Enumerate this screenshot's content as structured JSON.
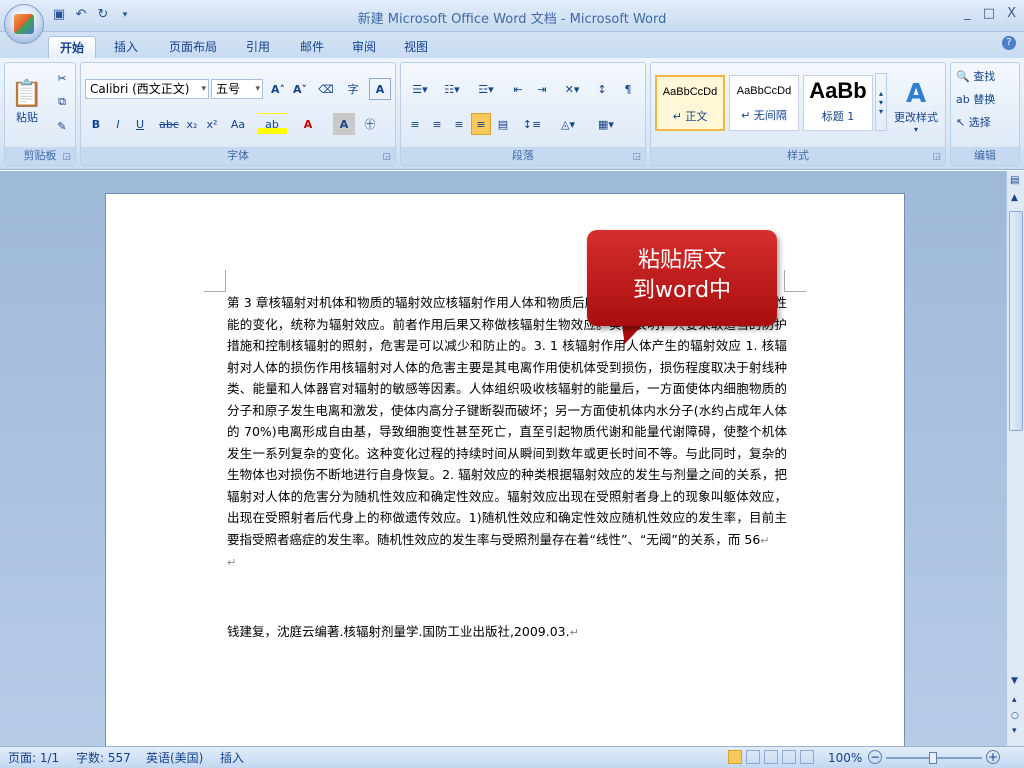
{
  "window": {
    "title": "新建 Microsoft Office Word 文档 - Microsoft Word",
    "min": "_",
    "max": "□",
    "close": "X"
  },
  "tabs": [
    "开始",
    "插入",
    "页面布局",
    "引用",
    "邮件",
    "审阅",
    "视图"
  ],
  "ribbon": {
    "clipboard": {
      "paste": "粘贴",
      "label": "剪贴板"
    },
    "font": {
      "name": "Calibri (西文正文)",
      "size": "五号",
      "label": "字体"
    },
    "paragraph": {
      "label": "段落"
    },
    "styles": {
      "label": "样式",
      "items": [
        {
          "preview": "AaBbCcDd",
          "name": "↵ 正文"
        },
        {
          "preview": "AaBbCcDd",
          "name": "↵ 无间隔"
        },
        {
          "preview": "AaBb",
          "name": "标题 1"
        }
      ],
      "change": "更改样式"
    },
    "editing": {
      "find": "查找",
      "replace": "替换",
      "select": "选择",
      "label": "编辑"
    }
  },
  "callout": {
    "line1": "粘贴原文",
    "line2": "到word中"
  },
  "document": {
    "body": "第 3 章核辐射对机体和物质的辐射效应核辐射作用人体和物质后所产生的各种生物学变化以及物质性能的变化，统称为辐射效应。前者作用后果又称做核辐射生物效应。实践表明，只要采取适当的防护措施和控制核辐射的照射，危害是可以减少和防止的。3. 1 核辐射作用人体产生的辐射效应 1. 核辐射对人体的损伤作用核辐射对人体的危害主要是其电离作用使机体受到损伤，损伤程度取决于射线种类、能量和人体器官对辐射的敏感等因素。人体组织吸收核辐射的能量后，一方面使体内细胞物质的分子和原子发生电离和激发，使体内高分子键断裂而破坏；另一方面使机体内水分子(水约占成年人体的 70%)电离形成自由基，导致细胞变性甚至死亡，直至引起物质代谢和能量代谢障碍，使整个机体发生一系列复杂的变化。这种变化过程的持续时间从瞬间到数年或更长时间不等。与此同时，复杂的生物体也对损伤不断地进行自身恢复。2. 辐射效应的种类根据辐射效应的发生与剂量之间的关系，把辐射对人体的危害分为随机性效应和确定性效应。辐射效应出现在受照射者身上的现象叫躯体效应，出现在受照射者后代身上的称做遗传效应。1)随机性效应和确定性效应随机性效应的发生率，目前主要指受照者癌症的发生率。随机性效应的发生率与受照剂量存在着“线性”、“无阈”的关系，而 56",
    "empty_mark": "↵",
    "citation": "钱建复，沈庭云编著.核辐射剂量学.国防工业出版社,2009.03."
  },
  "status": {
    "page": "页面: 1/1",
    "words": "字数: 557",
    "language": "英语(美国)",
    "mode": "插入",
    "zoom": "100%"
  }
}
